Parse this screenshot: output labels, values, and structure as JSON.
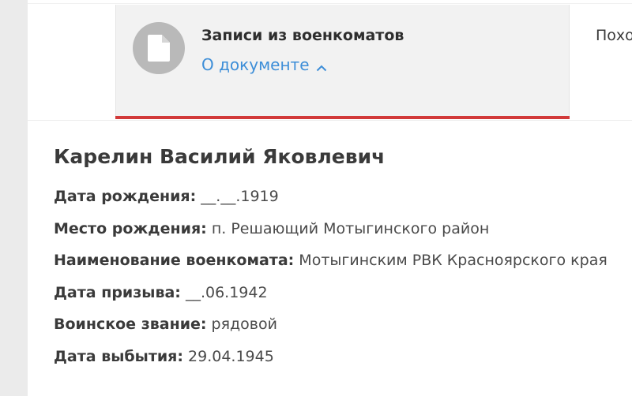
{
  "document_tab": {
    "title": "Записи из военкоматов",
    "link_label": "О документе",
    "icon": "document-icon",
    "accent_color": "#d23a3a"
  },
  "next_tab": {
    "label": "Похо"
  },
  "person": {
    "name": "Карелин Василий Яковлевич",
    "fields": [
      {
        "label": "Дата рождения:",
        "value": "__.__.1919"
      },
      {
        "label": "Место рождения:",
        "value": "п. Решающий Мотыгинского район"
      },
      {
        "label": "Наименование военкомата:",
        "value": "Мотыгинским РВК Красноярского края"
      },
      {
        "label": "Дата призыва:",
        "value": "__.06.1942"
      },
      {
        "label": "Воинское звание:",
        "value": "рядовой"
      },
      {
        "label": "Дата выбытия:",
        "value": "29.04.1945"
      }
    ]
  },
  "colors": {
    "link": "#3d8ed8",
    "tab_background": "#f2f2f2",
    "icon_circle": "#b9b9b9"
  }
}
